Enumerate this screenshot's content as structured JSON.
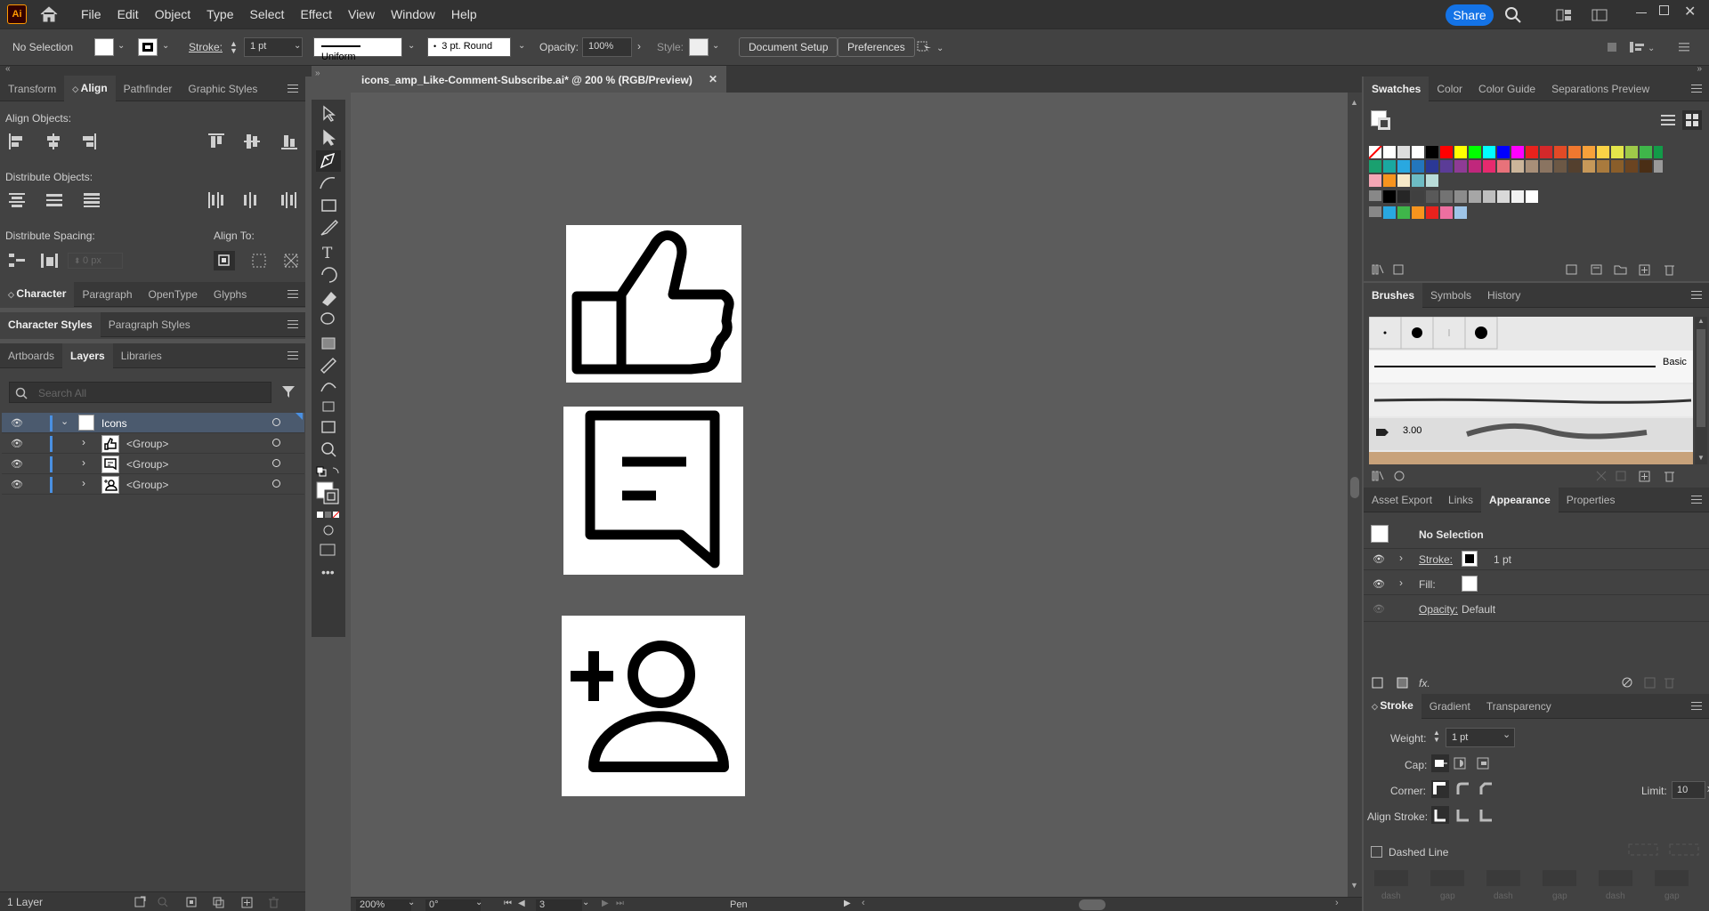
{
  "app": {
    "logo": "Ai"
  },
  "menu": [
    "File",
    "Edit",
    "Object",
    "Type",
    "Select",
    "Effect",
    "View",
    "Window",
    "Help"
  ],
  "topbar": {
    "share": "Share"
  },
  "control": {
    "selection": "No Selection",
    "stroke_label": "Stroke:",
    "stroke_value": "1 pt",
    "profile": "Uniform",
    "brush": "3 pt. Round",
    "opacity_label": "Opacity:",
    "opacity_value": "100%",
    "style_label": "Style:",
    "doc_setup": "Document Setup",
    "preferences": "Preferences"
  },
  "left_panel": {
    "tabs": [
      "Transform",
      "Align",
      "Pathfinder",
      "Graphic Styles"
    ],
    "align_objects": "Align Objects:",
    "distribute_objects": "Distribute Objects:",
    "distribute_spacing": "Distribute Spacing:",
    "align_to": "Align To:",
    "spacing_value": "0 px",
    "char_tabs": [
      "Character",
      "Paragraph",
      "OpenType",
      "Glyphs"
    ],
    "style_tabs": [
      "Character Styles",
      "Paragraph Styles"
    ],
    "layer_tabs": [
      "Artboards",
      "Layers",
      "Libraries"
    ],
    "search_placeholder": "Search All",
    "layers": [
      {
        "name": "Icons"
      },
      {
        "name": "<Group>"
      },
      {
        "name": "<Group>"
      },
      {
        "name": "<Group>"
      }
    ],
    "footer": "1 Layer"
  },
  "document": {
    "tab_title": "icons_amp_Like-Comment-Subscribe.ai* @ 200 % (RGB/Preview)",
    "zoom": "200%",
    "rotation": "0°",
    "artboard_num": "3",
    "tool": "Pen"
  },
  "right_panel": {
    "swatch_tabs": [
      "Swatches",
      "Color",
      "Color Guide",
      "Separations Preview"
    ],
    "brush_tabs": [
      "Brushes",
      "Symbols",
      "History"
    ],
    "brush_basic": "Basic",
    "brush_size": "3.00",
    "appear_tabs": [
      "Asset Export",
      "Links",
      "Appearance",
      "Properties"
    ],
    "appear_selection": "No Selection",
    "stroke_label": "Stroke:",
    "stroke_value": "1 pt",
    "fill_label": "Fill:",
    "opacity_label": "Opacity:",
    "opacity_value": "Default",
    "stroke_tabs": [
      "Stroke",
      "Gradient",
      "Transparency"
    ],
    "weight_label": "Weight:",
    "weight_value": "1 pt",
    "cap_label": "Cap:",
    "corner_label": "Corner:",
    "limit_label": "Limit:",
    "limit_value": "10",
    "align_stroke_label": "Align Stroke:",
    "dashed_label": "Dashed Line",
    "dash_labels": [
      "dash",
      "gap",
      "dash",
      "gap",
      "dash",
      "gap"
    ]
  },
  "colors": {
    "accent": "#1473e6",
    "panel": "#424242",
    "canvas": "#535353",
    "layer_sel": "#4b5a6e"
  }
}
